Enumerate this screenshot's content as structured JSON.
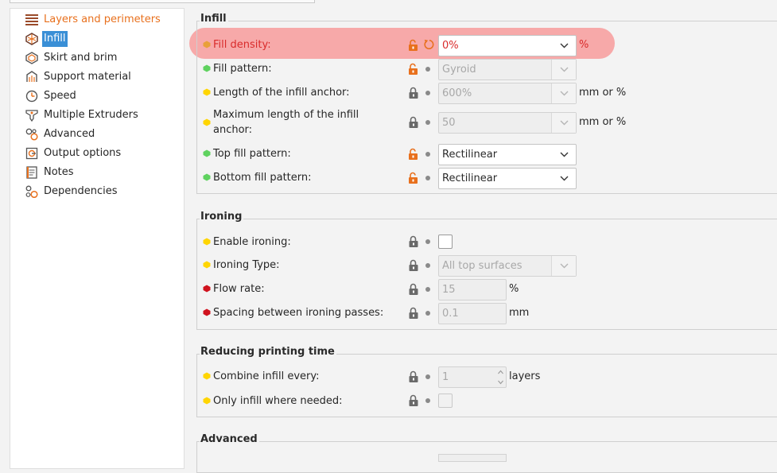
{
  "sidebar": {
    "items": [
      {
        "label": "Layers and perimeters",
        "icon": "layers-icon"
      },
      {
        "label": "Infill",
        "icon": "infill-icon"
      },
      {
        "label": "Skirt and brim",
        "icon": "skirt-icon"
      },
      {
        "label": "Support material",
        "icon": "support-icon"
      },
      {
        "label": "Speed",
        "icon": "speed-icon"
      },
      {
        "label": "Multiple Extruders",
        "icon": "extruders-icon"
      },
      {
        "label": "Advanced",
        "icon": "advanced-icon"
      },
      {
        "label": "Output options",
        "icon": "output-icon"
      },
      {
        "label": "Notes",
        "icon": "notes-icon"
      },
      {
        "label": "Dependencies",
        "icon": "dependencies-icon"
      }
    ],
    "selected": "Infill"
  },
  "infill": {
    "title": "Infill",
    "fill_density": {
      "label": "Fill density:",
      "value": "0%",
      "unit": "%"
    },
    "fill_pattern": {
      "label": "Fill pattern:",
      "value": "Gyroid"
    },
    "anchor_length": {
      "label": "Length of the infill anchor:",
      "value": "600%",
      "unit": "mm or %"
    },
    "anchor_max": {
      "label_line1": "Maximum length of the infill",
      "label_line2": "anchor:",
      "value": "50",
      "unit": "mm or %"
    },
    "top_fill": {
      "label": "Top fill pattern:",
      "value": "Rectilinear"
    },
    "bottom_fill": {
      "label": "Bottom fill pattern:",
      "value": "Rectilinear"
    }
  },
  "ironing": {
    "title": "Ironing",
    "enable": {
      "label": "Enable ironing:"
    },
    "type": {
      "label": "Ironing Type:",
      "value": "All top surfaces"
    },
    "flow_rate": {
      "label": "Flow rate:",
      "value": "15",
      "unit": "%"
    },
    "spacing": {
      "label": "Spacing between ironing passes:",
      "value": "0.1",
      "unit": "mm"
    }
  },
  "reducing": {
    "title": "Reducing printing time",
    "combine": {
      "label": "Combine infill every:",
      "value": "1",
      "unit": "layers"
    },
    "only_needed": {
      "label": "Only infill where needed:"
    }
  },
  "advanced": {
    "title": "Advanced"
  },
  "colors": {
    "accent_orange": "#e8701d",
    "selected_blue": "#3a8fd6",
    "dot_orange": "#e8a03a",
    "dot_green": "#5fd25f",
    "dot_yellow": "#ffd500",
    "dot_red": "#d0131e",
    "highlight": "#f58282"
  }
}
